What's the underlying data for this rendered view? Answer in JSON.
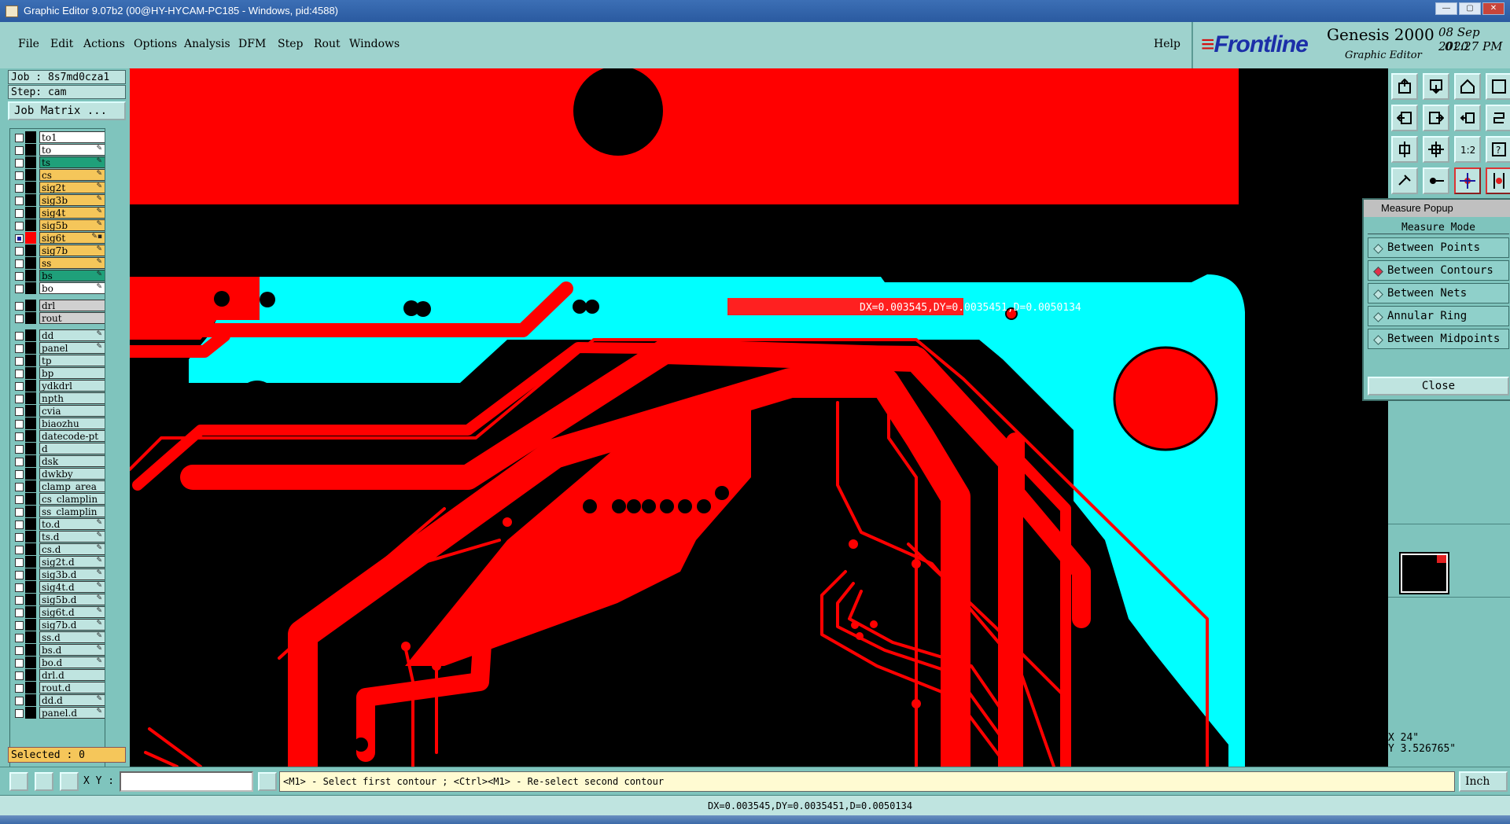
{
  "window": {
    "title": "Graphic Editor 9.07b2 (00@HY-HYCAM-PC185 - Windows, pid:4588)"
  },
  "menu": [
    "File",
    "Edit",
    "Actions",
    "Options",
    "Analysis",
    "DFM",
    "Step",
    "Rout",
    "Windows"
  ],
  "help": "Help",
  "brand": {
    "logo": "Frontline",
    "product": "Genesis 2000",
    "subtitle": "Graphic Editor",
    "date": "08 Sep 2020",
    "time": "01:27 PM"
  },
  "job": {
    "job_label": "Job : 8s7md0cza1",
    "step_label": "Step: cam",
    "matrix_button": "Job Matrix ..."
  },
  "layers": [
    {
      "name": "to1",
      "color": "#ffffff",
      "icon": ""
    },
    {
      "name": "to",
      "color": "#ffffff",
      "icon": "✎"
    },
    {
      "name": "ts",
      "color": "#1fa07a",
      "icon": "✎"
    },
    {
      "name": "cs",
      "color": "#f5c65a",
      "icon": "✎"
    },
    {
      "name": "sig2t",
      "color": "#f5c65a",
      "icon": "✎"
    },
    {
      "name": "sig3b",
      "color": "#f5c65a",
      "icon": "✎"
    },
    {
      "name": "sig4t",
      "color": "#f5c65a",
      "icon": "✎"
    },
    {
      "name": "sig5b",
      "color": "#f5c65a",
      "icon": "✎"
    },
    {
      "name": "sig6t",
      "color": "#f5c65a",
      "icon": "✎▪",
      "active": true
    },
    {
      "name": "sig7b",
      "color": "#f5c65a",
      "icon": "✎"
    },
    {
      "name": "ss",
      "color": "#f5c65a",
      "icon": "✎"
    },
    {
      "name": "bs",
      "color": "#1fa07a",
      "icon": "✎"
    },
    {
      "name": "bo",
      "color": "#ffffff",
      "icon": "✎"
    },
    {
      "name": "drl",
      "color": "#d0d0d0",
      "icon": "",
      "gap": true
    },
    {
      "name": "rout",
      "color": "#d0d0d0",
      "icon": ""
    },
    {
      "name": "dd",
      "color": "#bfe4e0",
      "icon": "✎",
      "gap": true
    },
    {
      "name": "panel",
      "color": "#bfe4e0",
      "icon": "✎"
    },
    {
      "name": "tp",
      "color": "#bfe4e0",
      "icon": ""
    },
    {
      "name": "bp",
      "color": "#bfe4e0",
      "icon": ""
    },
    {
      "name": "ydkdrl",
      "color": "#bfe4e0",
      "icon": ""
    },
    {
      "name": "npth",
      "color": "#bfe4e0",
      "icon": ""
    },
    {
      "name": "cvia",
      "color": "#bfe4e0",
      "icon": ""
    },
    {
      "name": "biaozhu",
      "color": "#bfe4e0",
      "icon": ""
    },
    {
      "name": "datecode-pt",
      "color": "#bfe4e0",
      "icon": ""
    },
    {
      "name": "d",
      "color": "#bfe4e0",
      "icon": ""
    },
    {
      "name": "dsk",
      "color": "#bfe4e0",
      "icon": ""
    },
    {
      "name": "dwkby",
      "color": "#bfe4e0",
      "icon": ""
    },
    {
      "name": "clamp_area",
      "color": "#bfe4e0",
      "icon": ""
    },
    {
      "name": "cs_clamplin",
      "color": "#bfe4e0",
      "icon": ""
    },
    {
      "name": "ss_clamplin",
      "color": "#bfe4e0",
      "icon": ""
    },
    {
      "name": "to.d",
      "color": "#bfe4e0",
      "icon": "✎"
    },
    {
      "name": "ts.d",
      "color": "#bfe4e0",
      "icon": "✎"
    },
    {
      "name": "cs.d",
      "color": "#bfe4e0",
      "icon": "✎"
    },
    {
      "name": "sig2t.d",
      "color": "#bfe4e0",
      "icon": "✎"
    },
    {
      "name": "sig3b.d",
      "color": "#bfe4e0",
      "icon": "✎"
    },
    {
      "name": "sig4t.d",
      "color": "#bfe4e0",
      "icon": "✎"
    },
    {
      "name": "sig5b.d",
      "color": "#bfe4e0",
      "icon": "✎"
    },
    {
      "name": "sig6t.d",
      "color": "#bfe4e0",
      "icon": "✎"
    },
    {
      "name": "sig7b.d",
      "color": "#bfe4e0",
      "icon": "✎"
    },
    {
      "name": "ss.d",
      "color": "#bfe4e0",
      "icon": "✎"
    },
    {
      "name": "bs.d",
      "color": "#bfe4e0",
      "icon": "✎"
    },
    {
      "name": "bo.d",
      "color": "#bfe4e0",
      "icon": "✎"
    },
    {
      "name": "drl.d",
      "color": "#bfe4e0",
      "icon": ""
    },
    {
      "name": "rout.d",
      "color": "#bfe4e0",
      "icon": ""
    },
    {
      "name": "dd.d",
      "color": "#bfe4e0",
      "icon": "✎"
    },
    {
      "name": "panel.d",
      "color": "#bfe4e0",
      "icon": "✎"
    }
  ],
  "selected": "Selected : 0",
  "measure_overlay": "DX=0.003545,DY=0.0035451,D=0.0050134",
  "measure_popup": {
    "title": "Measure Popup",
    "header": "Measure Mode",
    "options": [
      "Between Points",
      "Between Contours",
      "Between Nets",
      "Annular Ring",
      "Between Midpoints"
    ],
    "selected_option": "Between Contours",
    "close": "Close"
  },
  "coords": {
    "x": "X       24\"",
    "y": "Y   3.526765\""
  },
  "command": {
    "xy_label": "X Y :",
    "xy_value": "",
    "prompt": "<M1> - Select first contour ; <Ctrl><M1> - Re-select second contour",
    "unit": "Inch"
  },
  "status": "DX=0.003545,DY=0.0035451,D=0.0050134",
  "colors": {
    "copper": "#ff0000",
    "mask": "#00ffff",
    "canvas": "#000000",
    "panel": "#7fc4bd"
  }
}
